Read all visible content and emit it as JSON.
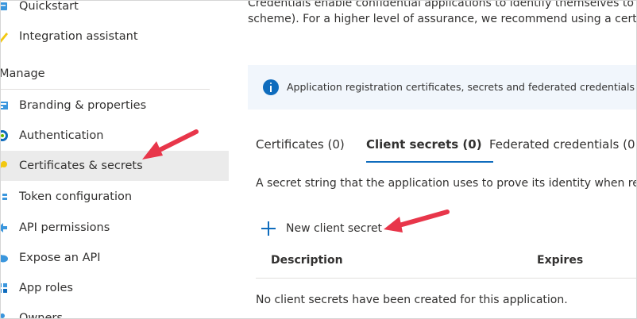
{
  "colors": {
    "accent": "#0f6cbd",
    "selected_bg": "#ebebeb",
    "info_bg": "#f1f6fc",
    "annotation": "#e8364a"
  },
  "sidebar": {
    "section_title": "Manage",
    "items": [
      {
        "label": "Quickstart",
        "icon": "quickstart-icon"
      },
      {
        "label": "Integration assistant",
        "icon": "rocket-icon"
      },
      {
        "label": "Branding & properties",
        "icon": "branding-icon"
      },
      {
        "label": "Authentication",
        "icon": "authentication-icon"
      },
      {
        "label": "Certificates & secrets",
        "icon": "key-icon",
        "selected": true
      },
      {
        "label": "Token configuration",
        "icon": "token-icon"
      },
      {
        "label": "API permissions",
        "icon": "api-permissions-icon"
      },
      {
        "label": "Expose an API",
        "icon": "cloud-icon"
      },
      {
        "label": "App roles",
        "icon": "app-roles-icon"
      },
      {
        "label": "Owners",
        "icon": "owners-icon"
      }
    ]
  },
  "main": {
    "intro_line1": "Credentials enable confidential applications to identify themselves to the",
    "intro_line2": "scheme). For a higher level of assurance, we recommend using a certific",
    "info_text": "Application registration certificates, secrets and federated credentials can",
    "tabs": [
      {
        "label": "Certificates (0)",
        "active": false
      },
      {
        "label": "Client secrets (0)",
        "active": true
      },
      {
        "label": "Federated credentials (0",
        "active": false
      }
    ],
    "description": "A secret string that the application uses to prove its identity when requ",
    "new_secret_label": "New client secret",
    "table": {
      "headers": [
        "Description",
        "Expires"
      ],
      "empty_message": "No client secrets have been created for this application."
    }
  }
}
